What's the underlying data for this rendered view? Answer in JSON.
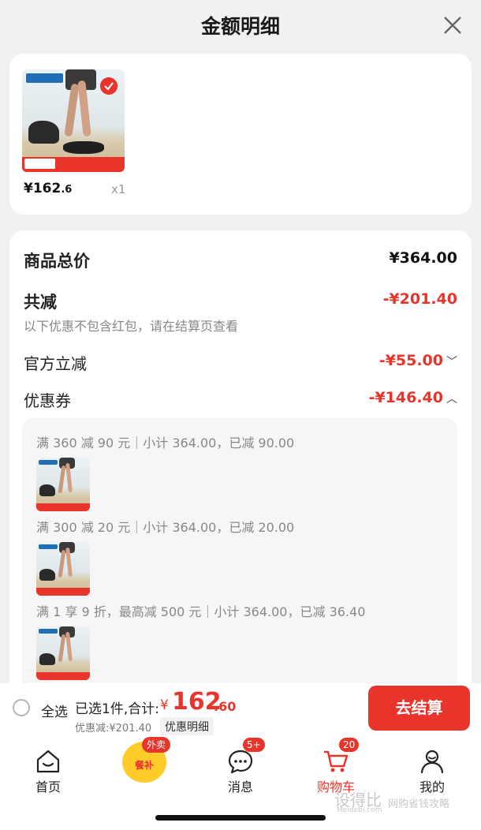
{
  "header": {
    "title": "金额明细"
  },
  "product": {
    "price_main": "¥162",
    "price_dec": ".6",
    "qty": "x1"
  },
  "summary": {
    "total_label": "商品总价",
    "total_value": "¥364.00",
    "reduce_label": "共减",
    "reduce_value": "-¥201.40",
    "note": "以下优惠不包含红包，请在结算页查看",
    "official_label": "官方立减",
    "official_value": "-¥55.00",
    "coupon_label": "优惠券",
    "coupon_value": "-¥146.40"
  },
  "coupons": [
    {
      "text": "满 360 减 90 元｜小计 364.00，已减 90.00"
    },
    {
      "text": "满 300 减 20 元｜小计 364.00，已减 20.00"
    },
    {
      "text": "满 1 享 9 折，最高减 500 元｜小计 364.00，已减 36.40"
    }
  ],
  "bottom": {
    "select_all": "全选",
    "selected": "已选1件,合计:",
    "yen": "¥",
    "total_int": "162",
    "total_dec": ".60",
    "discount": "优惠减:¥201.40",
    "detail": "优惠明细",
    "checkout": "去结算"
  },
  "tabs": [
    {
      "label": "首页"
    },
    {
      "label": "餐补",
      "badge": "外卖"
    },
    {
      "label": "消息",
      "badge": "5+"
    },
    {
      "label": "购物车",
      "badge": "20"
    },
    {
      "label": "我的"
    }
  ],
  "watermark": {
    "text": "设得比",
    "site": "Meidebi.com",
    "slogan": "网购省钱攻略"
  },
  "colors": {
    "accent": "#e8342a",
    "background": "#f1f1f3"
  }
}
